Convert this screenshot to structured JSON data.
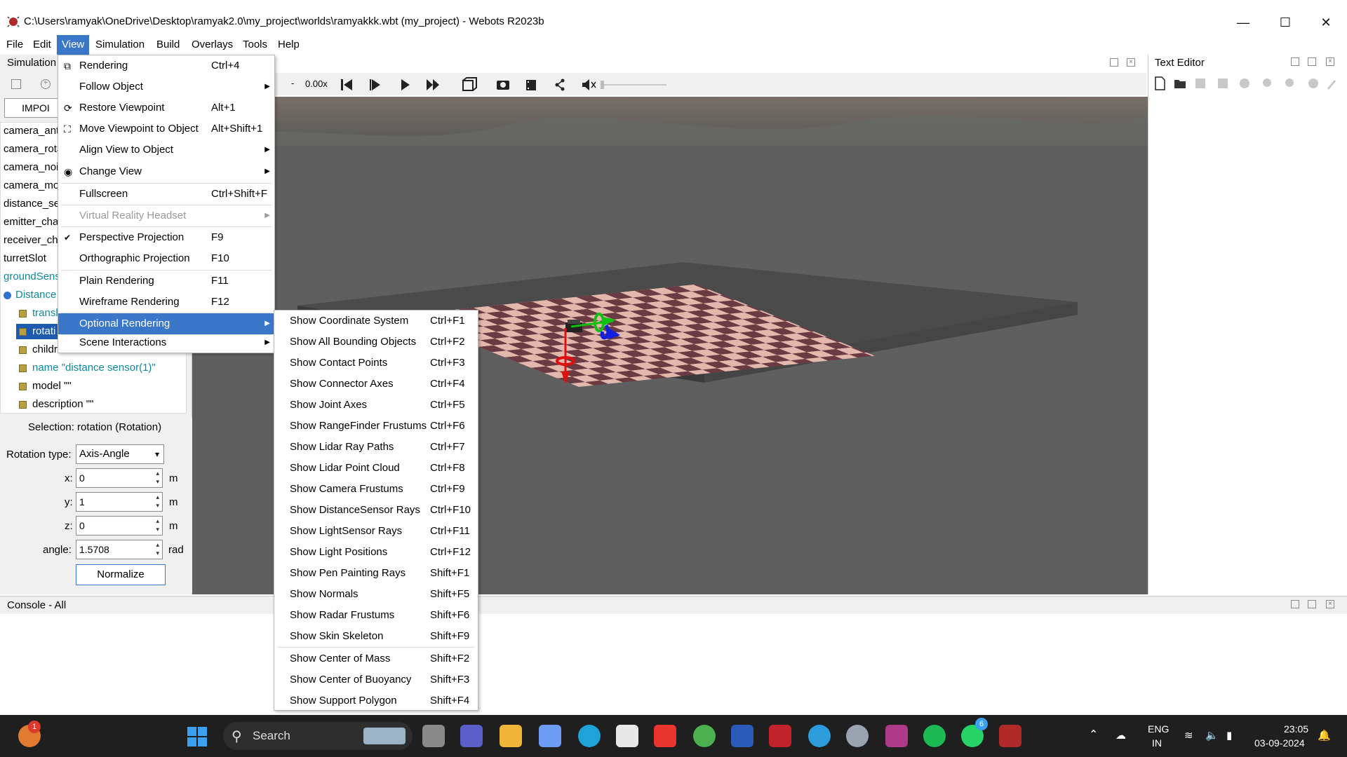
{
  "window": {
    "title": "C:\\Users\\ramyak\\OneDrive\\Desktop\\ramyak2.0\\my_project\\worlds\\ramyakkk.wbt (my_project) - Webots R2023b",
    "minimize_icon": "minimize-icon",
    "maximize_icon": "maximize-icon",
    "close_icon": "close-icon"
  },
  "menubar": [
    "File",
    "Edit",
    "View",
    "Simulation",
    "Build",
    "Overlays",
    "Tools",
    "Help"
  ],
  "scene_tree": {
    "panel_label": "Simulation",
    "import_label": "IMPOI",
    "rows": [
      {
        "text": "camera_ant",
        "color": "#000000"
      },
      {
        "text": "camera_rota",
        "color": "#000000"
      },
      {
        "text": "camera_noi",
        "color": "#000000"
      },
      {
        "text": "camera_mo",
        "color": "#000000"
      },
      {
        "text": "distance_se",
        "color": "#000000"
      },
      {
        "text": "emitter_cha",
        "color": "#000000"
      },
      {
        "text": "receiver_cha",
        "color": "#000000"
      },
      {
        "text": "turretSlot",
        "color": "#000000"
      },
      {
        "text": "groundSens",
        "color": "#0b8a9c"
      },
      {
        "text": "Distance",
        "color": "#0b8a9c"
      }
    ],
    "fields": [
      {
        "text": "transl"
      },
      {
        "text": "rotati"
      },
      {
        "text": "childre"
      },
      {
        "text": "name \"distance sensor(1)\""
      },
      {
        "text": "model \"\""
      },
      {
        "text": "description \"\""
      }
    ]
  },
  "field_editor": {
    "selection": "Selection: rotation (Rotation)",
    "rotation_type_label": "Rotation type:",
    "rotation_type_value": "Axis-Angle",
    "x_label": "x:",
    "x_value": "0",
    "x_unit": "m",
    "y_label": "y:",
    "y_value": "1",
    "y_unit": "m",
    "z_label": "z:",
    "z_value": "0",
    "z_unit": "m",
    "angle_label": "angle:",
    "angle_value": "1.5708",
    "angle_unit": "rad",
    "normalize_label": "Normalize"
  },
  "toolbar": {
    "speed_dash": "-",
    "speed": "0.00x"
  },
  "text_editor": {
    "label": "Text Editor"
  },
  "console": {
    "label": "Console - All"
  },
  "view_menu": [
    {
      "label": "Rendering",
      "shortcut": "Ctrl+4",
      "icon": "rendering-icon"
    },
    {
      "label": "Follow Object",
      "submenu": true
    },
    {
      "label": "Restore Viewpoint",
      "shortcut": "Alt+1",
      "icon": "restore-viewpoint-icon"
    },
    {
      "label": "Move Viewpoint to Object",
      "shortcut": "Alt+Shift+1",
      "icon": "move-viewpoint-icon"
    },
    {
      "label": "Align View to Object",
      "submenu": true
    },
    {
      "label": "Change View",
      "submenu": true,
      "icon": "eye-icon"
    },
    {
      "label": "Fullscreen",
      "shortcut": "Ctrl+Shift+F"
    },
    {
      "label": "Virtual Reality Headset",
      "submenu": true,
      "disabled": true
    },
    {
      "label": "Perspective Projection",
      "shortcut": "F9",
      "checked": true
    },
    {
      "label": "Orthographic Projection",
      "shortcut": "F10"
    },
    {
      "label": "Plain Rendering",
      "shortcut": "F11"
    },
    {
      "label": "Wireframe Rendering",
      "shortcut": "F12"
    },
    {
      "label": "Optional Rendering",
      "submenu": true,
      "highlighted": true
    },
    {
      "label": "Scene Interactions",
      "submenu": true
    }
  ],
  "optional_menu": [
    {
      "label": "Show Coordinate System",
      "shortcut": "Ctrl+F1"
    },
    {
      "label": "Show All Bounding Objects",
      "shortcut": "Ctrl+F2"
    },
    {
      "label": "Show Contact Points",
      "shortcut": "Ctrl+F3"
    },
    {
      "label": "Show Connector Axes",
      "shortcut": "Ctrl+F4"
    },
    {
      "label": "Show Joint Axes",
      "shortcut": "Ctrl+F5"
    },
    {
      "label": "Show RangeFinder Frustums",
      "shortcut": "Ctrl+F6"
    },
    {
      "label": "Show Lidar Ray Paths",
      "shortcut": "Ctrl+F7"
    },
    {
      "label": "Show Lidar Point Cloud",
      "shortcut": "Ctrl+F8"
    },
    {
      "label": "Show Camera Frustums",
      "shortcut": "Ctrl+F9"
    },
    {
      "label": "Show DistanceSensor Rays",
      "shortcut": "Ctrl+F10"
    },
    {
      "label": "Show LightSensor Rays",
      "shortcut": "Ctrl+F11"
    },
    {
      "label": "Show Light Positions",
      "shortcut": "Ctrl+F12"
    },
    {
      "label": "Show Pen Painting Rays",
      "shortcut": "Shift+F1"
    },
    {
      "label": "Show Normals",
      "shortcut": "Shift+F5"
    },
    {
      "label": "Show Radar Frustums",
      "shortcut": "Shift+F6"
    },
    {
      "label": "Show Skin Skeleton",
      "shortcut": "Shift+F9"
    },
    {
      "label": "Show Center of Mass",
      "shortcut": "Shift+F2"
    },
    {
      "label": "Show Center of Buoyancy",
      "shortcut": "Shift+F3"
    },
    {
      "label": "Show Support Polygon",
      "shortcut": "Shift+F4"
    }
  ],
  "taskbar": {
    "search_placeholder": "Search",
    "language_top": "ENG",
    "language_bottom": "IN",
    "time": "23:05",
    "date": "03-09-2024",
    "weather_badge": "1",
    "whatsapp_badge": "6",
    "apps": [
      {
        "name": "files-icon",
        "color": "#8a8a8a"
      },
      {
        "name": "teams-icon",
        "color": "#5b5fc7"
      },
      {
        "name": "explorer-icon",
        "color": "#f2b53b"
      },
      {
        "name": "copilot-icon",
        "color": "#6f9df5"
      },
      {
        "name": "edge-icon",
        "color": "#1fa2d8"
      },
      {
        "name": "store-icon",
        "color": "#e8e8e8"
      },
      {
        "name": "anydesk-icon",
        "color": "#e8362f"
      },
      {
        "name": "chrome-icon",
        "color": "#4caf50"
      },
      {
        "name": "word-icon",
        "color": "#2b5ab8"
      },
      {
        "name": "mcafee-icon",
        "color": "#c0232b"
      },
      {
        "name": "help-icon",
        "color": "#2d9cdb"
      },
      {
        "name": "settings-icon",
        "color": "#9aa3b0"
      },
      {
        "name": "winrar-icon",
        "color": "#b03a8a"
      },
      {
        "name": "spotify-icon",
        "color": "#1db954"
      },
      {
        "name": "whatsapp-icon",
        "color": "#25d366"
      },
      {
        "name": "webots-icon",
        "color": "#b02a2a"
      }
    ]
  },
  "colors": {
    "accent": "#3b77c9",
    "taskbar": "#1f1f1f",
    "floor_dark": "#6b3b44",
    "floor_light": "#e2b8ac"
  }
}
